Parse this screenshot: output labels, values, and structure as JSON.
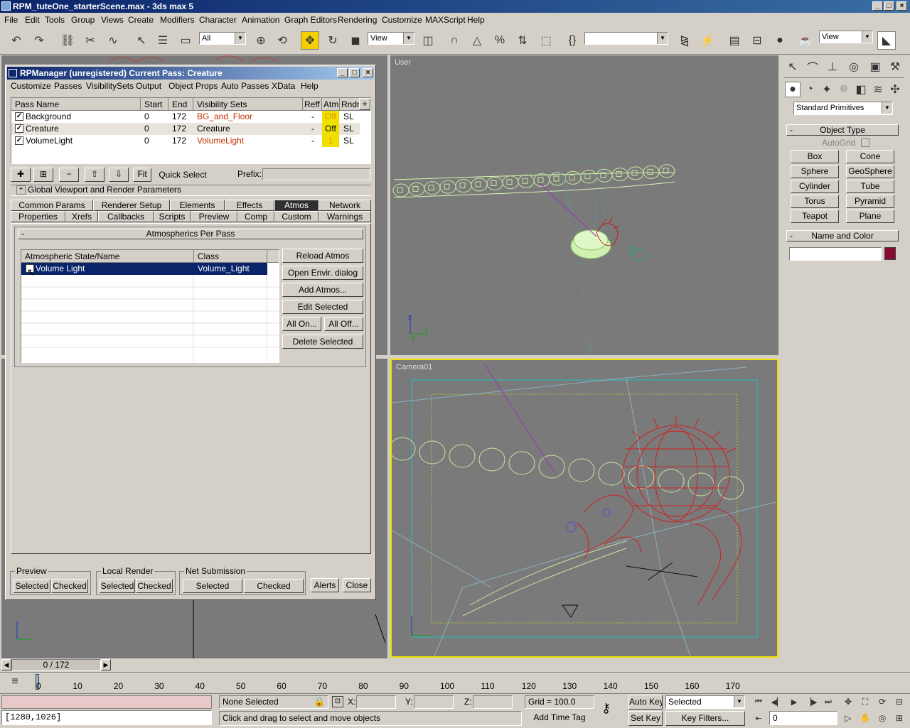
{
  "window": {
    "title": "RPM_tuteOne_starterScene.max - 3ds max 5"
  },
  "menu": [
    "File",
    "Edit",
    "Tools",
    "Group",
    "Views",
    "Create",
    "Modifiers",
    "Character",
    "Animation",
    "Graph Editors",
    "Rendering",
    "Customize",
    "MAXScript",
    "Help"
  ],
  "toolbar": {
    "filter_value": "All",
    "refcoord_value": "View",
    "named_sel_value": "",
    "render_view_value": "View"
  },
  "viewports": {
    "top_label": "User",
    "bottom_label": "Camera01"
  },
  "dialog": {
    "title": "RPManager (unregistered)   Current Pass: Creature",
    "menu": [
      "Customize",
      "Passes",
      "VisibilitySets",
      "Output",
      "Object Props",
      "Auto Passes",
      "XData",
      "Help"
    ],
    "pass_table": {
      "headers": [
        "Pass Name",
        "Start",
        "End",
        "Visibility Sets",
        "Reff",
        "Atm",
        "Rndr"
      ],
      "rows": [
        {
          "checked": "✓",
          "name": "Background",
          "start": "0",
          "end": "172",
          "vis": "BG_and_Floor",
          "reff": "-",
          "atm": "Off",
          "rndr": "SL"
        },
        {
          "checked": "✓",
          "name": "Creature",
          "start": "0",
          "end": "172",
          "vis": "Creature",
          "reff": "-",
          "atm": "Off",
          "rndr": "SL"
        },
        {
          "checked": "✓",
          "name": "VolumeLight",
          "start": "0",
          "end": "172",
          "vis": "VolumeLight",
          "reff": "-",
          "atm": "1",
          "rndr": "SL"
        }
      ],
      "plus": "+"
    },
    "buttons": {
      "fit": "Fit",
      "quick_select": "Quick Select",
      "prefix_label": "Prefix:"
    },
    "global_params": "Global Viewport and Render Parameters",
    "global_params_toggle": "+",
    "tabs_row1": [
      "Common Params",
      "Renderer Setup",
      "Elements",
      "Effects",
      "Atmos",
      "Network"
    ],
    "tabs_row2": [
      "Properties",
      "Xrefs",
      "Callbacks",
      "Scripts",
      "Preview",
      "Comp",
      "Custom",
      "Warnings"
    ],
    "selected_tab": "Atmos",
    "rollout": {
      "toggle": "-",
      "title": "Atmospherics Per Pass"
    },
    "atmos_table": {
      "headers": [
        "Atmospheric State/Name",
        "Class"
      ],
      "rows": [
        {
          "name": "Volume Light",
          "class": "Volume_Light"
        }
      ]
    },
    "atmos_buttons": {
      "reload": "Reload Atmos",
      "open_envir": "Open Envir. dialog",
      "add": "Add Atmos...",
      "edit": "Edit Selected",
      "all_on": "All On...",
      "all_off": "All Off...",
      "delete": "Delete Selected"
    },
    "bottom": {
      "preview": "Preview",
      "local_render": "Local Render",
      "net_submission": "Net Submission",
      "selected": "Selected",
      "checked": "Checked",
      "alerts": "Alerts",
      "close": "Close"
    }
  },
  "command_panel": {
    "dropdown": "Standard Primitives",
    "rollout_object_type": "Object Type",
    "autogrid": "AutoGrid",
    "primitives": [
      "Box",
      "Cone",
      "Sphere",
      "GeoSphere",
      "Cylinder",
      "Tube",
      "Torus",
      "Pyramid",
      "Teapot",
      "Plane"
    ],
    "rollout_name_color": "Name and Color",
    "collapse": "-",
    "swatch_color": "#8b0a32"
  },
  "timeline": {
    "slider": "0 / 172",
    "ticks": [
      "0",
      "10",
      "20",
      "30",
      "40",
      "50",
      "60",
      "70",
      "80",
      "90",
      "100",
      "110",
      "120",
      "130",
      "140",
      "150",
      "160",
      "170"
    ]
  },
  "status": {
    "selection": "None Selected",
    "x_label": "X:",
    "y_label": "Y:",
    "z_label": "Z:",
    "grid": "Grid = 100.0",
    "auto_key": "Auto Key",
    "set_key": "Set Key",
    "key_mode": "Selected",
    "key_filters": "Key Filters...",
    "prompt": "Click and drag to select and move objects",
    "add_time_tag": "Add Time Tag",
    "maxscript": "[1280,1026]",
    "frame": "0"
  }
}
